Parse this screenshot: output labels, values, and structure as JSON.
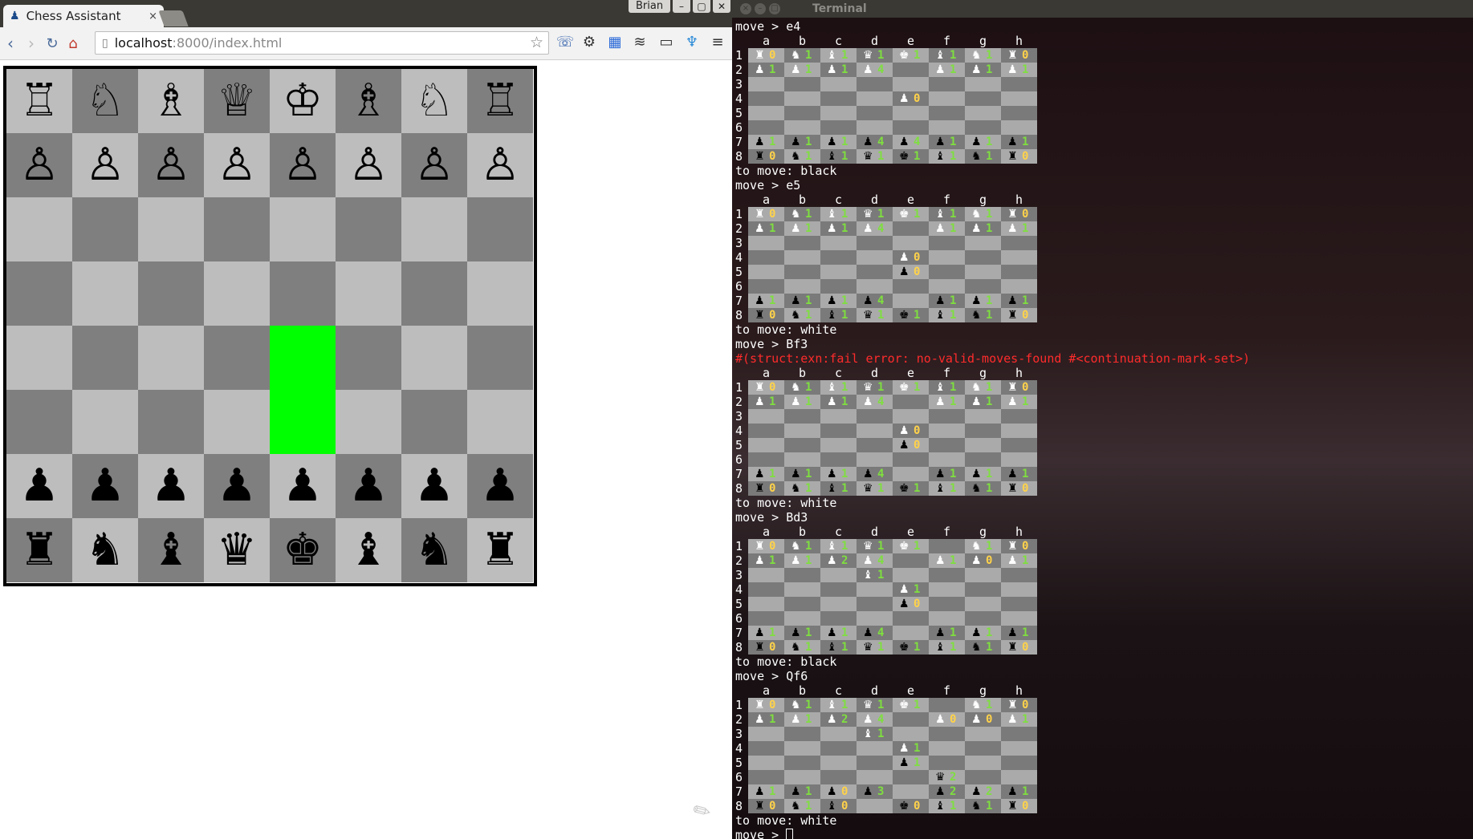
{
  "browser": {
    "tab_title": "Chess Assistant",
    "tab_close": "×",
    "user": "Brian",
    "url_host": "localhost",
    "url_path": ":8000/index.html",
    "window_buttons": [
      "–",
      "▢",
      "✕"
    ]
  },
  "board": {
    "highlight_color": "#00ff00",
    "highlighted_squares": [
      "e4",
      "e3"
    ],
    "ranks": [
      [
        "♖",
        "♘",
        "♗",
        "♕",
        "♔",
        "♗",
        "♘",
        "♖"
      ],
      [
        "♙",
        "♙",
        "♙",
        "♙",
        "♙",
        "♙",
        "♙",
        "♙"
      ],
      [
        "",
        "",
        "",
        "",
        "",
        "",
        "",
        ""
      ],
      [
        "",
        "",
        "",
        "",
        "",
        "",
        "",
        ""
      ],
      [
        "",
        "",
        "",
        "",
        "",
        "",
        "",
        ""
      ],
      [
        "",
        "",
        "",
        "",
        "",
        "",
        "",
        ""
      ],
      [
        "♟",
        "♟",
        "♟",
        "♟",
        "♟",
        "♟",
        "♟",
        "♟"
      ],
      [
        "♜",
        "♞",
        "♝",
        "♛",
        "♚",
        "♝",
        "♞",
        "♜"
      ]
    ]
  },
  "terminal": {
    "title": "Terminal",
    "files": [
      "a",
      "b",
      "c",
      "d",
      "e",
      "f",
      "g",
      "h"
    ],
    "lines": [
      {
        "t": "text",
        "s": "move > e4"
      },
      {
        "t": "board",
        "b": 0
      },
      {
        "t": "text",
        "s": "to move: black"
      },
      {
        "t": "text",
        "s": "move > e5"
      },
      {
        "t": "board",
        "b": 1
      },
      {
        "t": "text",
        "s": "to move: white"
      },
      {
        "t": "text",
        "s": "move > Bf3"
      },
      {
        "t": "error",
        "s": "#(struct:exn:fail error: no-valid-moves-found #<continuation-mark-set>)"
      },
      {
        "t": "board",
        "b": 2
      },
      {
        "t": "text",
        "s": "to move: white"
      },
      {
        "t": "text",
        "s": "move > Bd3"
      },
      {
        "t": "board",
        "b": 3
      },
      {
        "t": "text",
        "s": "to move: black"
      },
      {
        "t": "text",
        "s": "move > Qf6"
      },
      {
        "t": "board",
        "b": 4
      },
      {
        "t": "text",
        "s": "to move: white"
      },
      {
        "t": "prompt",
        "s": "move > "
      }
    ],
    "boards": [
      [
        [
          "♜W0",
          "♞W1",
          "♝W1",
          "♛W1",
          "♚W1",
          "♝W1",
          "♞W1",
          "♜W0"
        ],
        [
          "♟W1",
          "♟W1",
          "♟W1",
          "♟W4",
          "",
          "♟W1",
          "♟W1",
          "♟W1"
        ],
        [
          "",
          "",
          "",
          "",
          "",
          "",
          "",
          ""
        ],
        [
          "",
          "",
          "",
          "",
          "♟W0",
          "",
          "",
          ""
        ],
        [
          "",
          "",
          "",
          "",
          "",
          "",
          "",
          ""
        ],
        [
          "",
          "",
          "",
          "",
          "",
          "",
          "",
          ""
        ],
        [
          "♟B1",
          "♟B1",
          "♟B1",
          "♟B4",
          "♟B4",
          "♟B1",
          "♟B1",
          "♟B1"
        ],
        [
          "♜B0",
          "♞B1",
          "♝B1",
          "♛B1",
          "♚B1",
          "♝B1",
          "♞B1",
          "♜B0"
        ]
      ],
      [
        [
          "♜W0",
          "♞W1",
          "♝W1",
          "♛W1",
          "♚W1",
          "♝W1",
          "♞W1",
          "♜W0"
        ],
        [
          "♟W1",
          "♟W1",
          "♟W1",
          "♟W4",
          "",
          "♟W1",
          "♟W1",
          "♟W1"
        ],
        [
          "",
          "",
          "",
          "",
          "",
          "",
          "",
          ""
        ],
        [
          "",
          "",
          "",
          "",
          "♟W0",
          "",
          "",
          ""
        ],
        [
          "",
          "",
          "",
          "",
          "♟B0",
          "",
          "",
          ""
        ],
        [
          "",
          "",
          "",
          "",
          "",
          "",
          "",
          ""
        ],
        [
          "♟B1",
          "♟B1",
          "♟B1",
          "♟B4",
          "",
          "♟B1",
          "♟B1",
          "♟B1"
        ],
        [
          "♜B0",
          "♞B1",
          "♝B1",
          "♛B1",
          "♚B1",
          "♝B1",
          "♞B1",
          "♜B0"
        ]
      ],
      [
        [
          "♜W0",
          "♞W1",
          "♝W1",
          "♛W1",
          "♚W1",
          "♝W1",
          "♞W1",
          "♜W0"
        ],
        [
          "♟W1",
          "♟W1",
          "♟W1",
          "♟W4",
          "",
          "♟W1",
          "♟W1",
          "♟W1"
        ],
        [
          "",
          "",
          "",
          "",
          "",
          "",
          "",
          ""
        ],
        [
          "",
          "",
          "",
          "",
          "♟W0",
          "",
          "",
          ""
        ],
        [
          "",
          "",
          "",
          "",
          "♟B0",
          "",
          "",
          ""
        ],
        [
          "",
          "",
          "",
          "",
          "",
          "",
          "",
          ""
        ],
        [
          "♟B1",
          "♟B1",
          "♟B1",
          "♟B4",
          "",
          "♟B1",
          "♟B1",
          "♟B1"
        ],
        [
          "♜B0",
          "♞B1",
          "♝B1",
          "♛B1",
          "♚B1",
          "♝B1",
          "♞B1",
          "♜B0"
        ]
      ],
      [
        [
          "♜W0",
          "♞W1",
          "♝W1",
          "♛W1",
          "♚W1",
          "",
          "♞W1",
          "♜W0"
        ],
        [
          "♟W1",
          "♟W1",
          "♟W2",
          "♟W4",
          "",
          "♟W1",
          "♟W0",
          "♟W1"
        ],
        [
          "",
          "",
          "",
          "♝W1",
          "",
          "",
          "",
          ""
        ],
        [
          "",
          "",
          "",
          "",
          "♟W1",
          "",
          "",
          ""
        ],
        [
          "",
          "",
          "",
          "",
          "♟B0",
          "",
          "",
          ""
        ],
        [
          "",
          "",
          "",
          "",
          "",
          "",
          "",
          ""
        ],
        [
          "♟B1",
          "♟B1",
          "♟B1",
          "♟B4",
          "",
          "♟B1",
          "♟B1",
          "♟B1"
        ],
        [
          "♜B0",
          "♞B1",
          "♝B1",
          "♛B1",
          "♚B1",
          "♝B1",
          "♞B1",
          "♜B0"
        ]
      ],
      [
        [
          "♜W0",
          "♞W1",
          "♝W1",
          "♛W1",
          "♚W1",
          "",
          "♞W1",
          "♜W0"
        ],
        [
          "♟W1",
          "♟W1",
          "♟W2",
          "♟W4",
          "",
          "♟W0",
          "♟W0",
          "♟W1"
        ],
        [
          "",
          "",
          "",
          "♝W1",
          "",
          "",
          "",
          ""
        ],
        [
          "",
          "",
          "",
          "",
          "♟W1",
          "",
          "",
          ""
        ],
        [
          "",
          "",
          "",
          "",
          "♟B1",
          "",
          "",
          ""
        ],
        [
          "",
          "",
          "",
          "",
          "",
          "♛B2",
          "",
          ""
        ],
        [
          "♟B1",
          "♟B1",
          "♟B0",
          "♟B3",
          "",
          "♟B2",
          "♟B2",
          "♟B1"
        ],
        [
          "♜B0",
          "♞B1",
          "♝B0",
          "",
          "♚B0",
          "♝B1",
          "♞B1",
          "♜B0"
        ]
      ]
    ]
  }
}
